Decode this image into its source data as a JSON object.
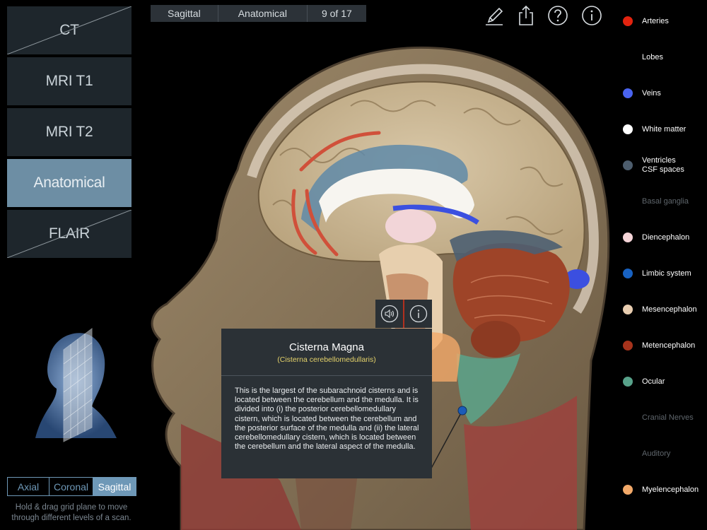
{
  "modalities": [
    {
      "label": "CT",
      "state": "disabled"
    },
    {
      "label": "MRI T1",
      "state": "normal"
    },
    {
      "label": "MRI T2",
      "state": "normal"
    },
    {
      "label": "Anatomical",
      "state": "active"
    },
    {
      "label": "FLAIR",
      "state": "disabled"
    }
  ],
  "planes": [
    {
      "label": "Axial",
      "active": false
    },
    {
      "label": "Coronal",
      "active": false
    },
    {
      "label": "Sagittal",
      "active": true
    }
  ],
  "plane_hint": "Hold & drag grid plane to move through different levels of a scan.",
  "breadcrumb": [
    "Sagittal",
    "Anatomical",
    "9 of 17"
  ],
  "toolbar_icons": [
    "pencil-icon",
    "share-icon",
    "help-icon",
    "info-icon"
  ],
  "popup": {
    "title": "Cisterna Magna",
    "latin": "(Cisterna cerebellomedullaris)",
    "body": "This is the largest of the subarachnoid cisterns and is located between the cerebellum and the medulla. It is divided into (i) the posterior cerebellomedullary cistern, which is located between the cerebellum and the posterior surface of the medulla and (ii) the lateral cerebellomedullary cistern, which is located between the cerebellum and the lateral aspect of the medulla.",
    "media_icons": [
      "speaker-icon",
      "info-icon"
    ]
  },
  "legend": [
    {
      "label": "Arteries",
      "color": "#e2230f",
      "on": true
    },
    {
      "label": "Lobes",
      "color": "",
      "on": true
    },
    {
      "label": "Veins",
      "color": "#4a64f0",
      "on": true
    },
    {
      "label": "White matter",
      "color": "#ffffff",
      "on": true
    },
    {
      "label": "Ventricles\nCSF spaces",
      "color": "#4d5d6d",
      "on": true
    },
    {
      "label": "Basal ganglia",
      "color": "",
      "on": false
    },
    {
      "label": "Diencephalon",
      "color": "#f5d5d8",
      "on": true
    },
    {
      "label": "Limbic system",
      "color": "#1862c2",
      "on": true
    },
    {
      "label": "Mesencephalon",
      "color": "#e8cdb0",
      "on": true
    },
    {
      "label": "Metencephalon",
      "color": "#a6331c",
      "on": true
    },
    {
      "label": "Ocular",
      "color": "#58a28a",
      "on": true
    },
    {
      "label": "Cranial Nerves",
      "color": "",
      "on": false
    },
    {
      "label": "Auditory",
      "color": "",
      "on": false
    },
    {
      "label": "Myelencephalon",
      "color": "#f2a969",
      "on": true
    }
  ]
}
